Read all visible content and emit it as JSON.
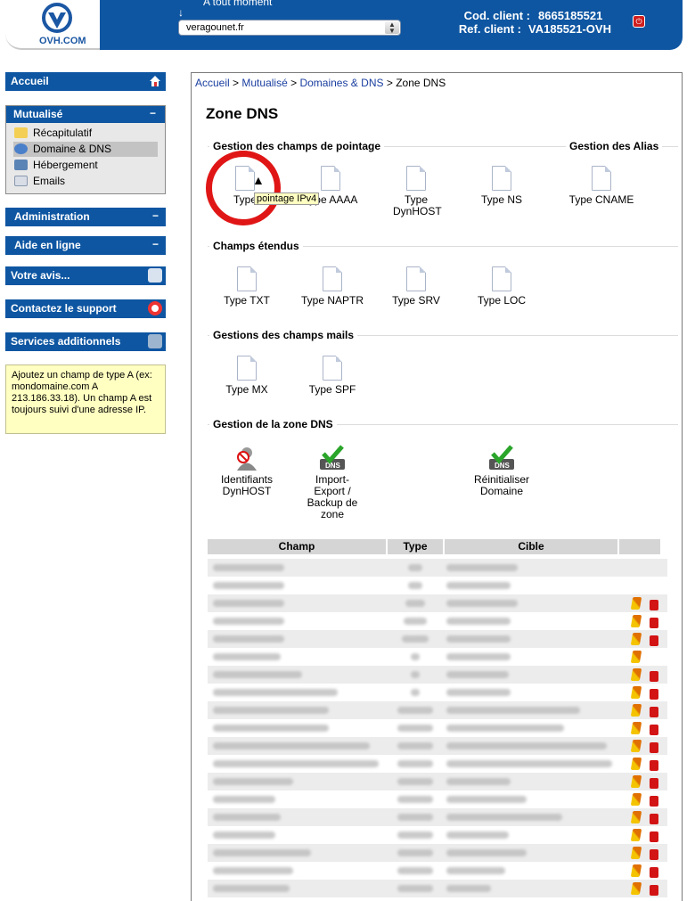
{
  "header": {
    "logo_text": "OVH.COM",
    "top_caption": "A tout moment",
    "site_select_value": "veragounet.fr",
    "client_code_label": "Cod. client :",
    "client_code_value": "8665185521",
    "client_ref_label": "Ref. client :",
    "client_ref_value": "VA185521-OVH"
  },
  "sidebar": {
    "accueil": "Accueil",
    "mutualise": "Mutualisé",
    "mutualise_toggle": "−",
    "mutualise_items": [
      "Récapitulatif",
      "Domaine & DNS",
      "Hébergement",
      "Emails"
    ],
    "administration": "Administration",
    "aide": "Aide en ligne",
    "avis": "Votre avis...",
    "contact": "Contactez le support",
    "services": "Services additionnels",
    "toggle": "−",
    "help_text": "Ajoutez un champ de type A (ex: mondomaine.com A 213.186.33.18). Un champ A est toujours suivi d'une adresse IP."
  },
  "breadcrumb": {
    "items": [
      "Accueil",
      "Mutualisé",
      "Domaines & DNS",
      "Zone DNS"
    ],
    "sep": ">"
  },
  "page_title": "Zone DNS",
  "sections": {
    "pointage": "Gestion des champs de pointage",
    "alias": "Gestion des Alias",
    "etendus": "Champs étendus",
    "mails": "Gestions des champs mails",
    "zone": "Gestion de la zone DNS"
  },
  "pointage_items": [
    "Type",
    "Type AAAA",
    "Type DynHOST",
    "Type NS"
  ],
  "alias_items": [
    "Type CNAME"
  ],
  "etendus_items": [
    "Type TXT",
    "Type NAPTR",
    "Type SRV",
    "Type LOC"
  ],
  "mails_items": [
    "Type MX",
    "Type SPF"
  ],
  "zone_items": [
    "Identifiants DynHOST",
    "Import-Export / Backup de zone",
    "Réinitialiser Domaine"
  ],
  "tooltip": "pointage IPv4",
  "table": {
    "headers": [
      "Champ",
      "Type",
      "Cible"
    ]
  },
  "colors": {
    "brand_blue": "#0e56a2",
    "highlight_red": "#e01616",
    "help_bg": "#ffffc1"
  }
}
